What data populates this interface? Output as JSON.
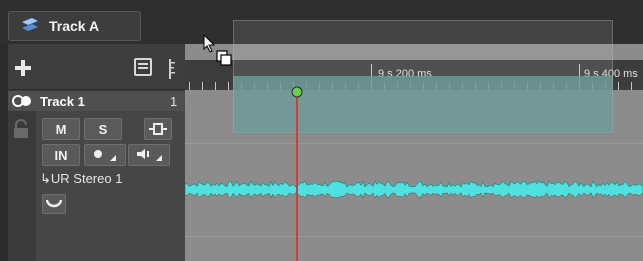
{
  "track_tab": {
    "label": "Track A"
  },
  "track": {
    "name": "Track 1",
    "number": "1",
    "routing": "↳UR Stereo 1"
  },
  "buttons": {
    "mute": "M",
    "solo": "S",
    "input": "IN"
  },
  "ruler": {
    "label_1": "9 s 200 ms",
    "label_2": "9 s 400 ms"
  },
  "colors": {
    "waveform": "#4fe0e0",
    "cursor": "#d83a3a",
    "event_bg": "#8c8c8c",
    "cursor_head": "#6ad04c"
  }
}
